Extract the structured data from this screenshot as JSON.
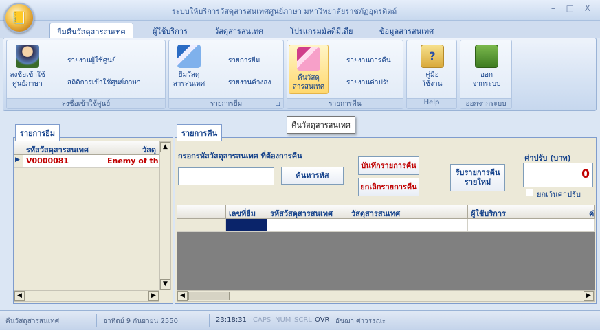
{
  "app": {
    "title": "ระบบให้บริการวัสดุสารสนเทศศูนย์ภาษา มหาวิทยาลัยราชภัฏอุตรดิตถ์",
    "window_controls": "– □ X"
  },
  "ribbon_tabs": [
    "ยืมคืนวัสดุสารสนเทศ",
    "ผู้ใช้บริการ",
    "วัสดุสารสนเทศ",
    "โปรแกรมมัลติมีเดีย",
    "ข้อมูลสารสนเทศ"
  ],
  "groups": {
    "login": {
      "caption": "ลงชื่อเข้าใช้ศูนย์",
      "big_label1": "ลงชื่อเข้าใช้",
      "big_label2": "ศูนย์ภาษา",
      "small1": "รายงานผู้ใช้ศูนย์",
      "small2": "สถิติการเข้าใช้ศูนย์ภาษา"
    },
    "borrow": {
      "caption": "รายการยืม",
      "big_label1": "ยืมวัสดุ",
      "big_label2": "สารสนเทศ",
      "small1": "รายการยืม",
      "small2": "รายงานค้างส่ง",
      "launcher": "⊡"
    },
    "return": {
      "caption": "รายการคืน",
      "big_label1": "คืนวัสดุ",
      "big_label2": "สารสนเทศ",
      "small1": "รายงานการคืน",
      "small2": "รายงานค่าปรับ"
    },
    "help": {
      "caption": "Help",
      "big_label1": "คู่มือ",
      "big_label2": "ใช้งาน"
    },
    "exit": {
      "caption": "ออกจากระบบ",
      "big_label1": "ออก",
      "big_label2": "จากระบบ"
    }
  },
  "tooltip": "คืนวัสดุสารสนเทศ",
  "left_panel": {
    "tab": "รายการยืม",
    "headers": [
      "รหัสวัสดุสารสนเทศ",
      "วัสดุ"
    ],
    "rows": [
      {
        "id": "V0000081",
        "title": "Enemy of th"
      }
    ]
  },
  "right_panel": {
    "tab": "รายการคืน",
    "input_label": "กรอกรหัสวัสดุสารสนเทศ ที่ต้องการคืน",
    "search_button": "ค้นหารหัส",
    "save_button": "บันทึกรายการคืน",
    "cancel_button": "ยกเลิกรายการคืน",
    "new_button_line1": "รับรายการคืน",
    "new_button_line2": "รายใหม่",
    "fine_label": "ค่าปรับ (บาท)",
    "fine_value": "0",
    "waive_label": "ยกเว้นค่าปรับ",
    "headers": [
      "เลขที่ยืม",
      "รหัสวัสดุสารสนเทศ",
      "วัสดุสารสนเทศ",
      "ผู้ใช้บริการ",
      "ค่า"
    ]
  },
  "status": {
    "mode": "คืนวัสดุสารสนเทศ",
    "date": "อาทิตย์ 9 กันยายน 2550",
    "time": "23:18:31",
    "caps": "CAPS",
    "num": "NUM",
    "scrl": "SCRL",
    "ovr": "OVR",
    "user": "อัชฌา ศาวรรณะ"
  },
  "colors": {
    "accent": "#15428b",
    "red": "#c00000",
    "selected_cell": "#0a246a"
  }
}
